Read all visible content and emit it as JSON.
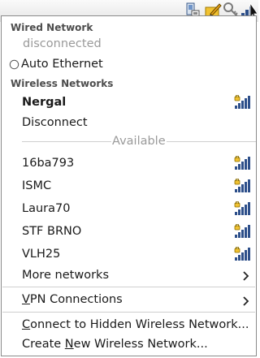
{
  "wired": {
    "header": "Wired Network",
    "status": "disconnected",
    "option": "Auto Ethernet"
  },
  "wireless": {
    "header": "Wireless Networks",
    "connected": "Nergal",
    "disconnect": "Disconnect",
    "available_label": "Available",
    "networks": [
      "16ba793",
      "ISMC",
      "Laura70",
      "STF BRNO",
      "VLH25"
    ],
    "more": "More networks"
  },
  "vpn": {
    "pre": "",
    "mnemonic": "V",
    "post": "PN Connections"
  },
  "hidden": {
    "pre": "",
    "mnemonic": "C",
    "post": "onnect to Hidden Wireless Network..."
  },
  "create": {
    "pre": "Create ",
    "mnemonic": "N",
    "post": "ew Wireless Network..."
  },
  "icons": {
    "tray": [
      "network-manager-icon",
      "edit-icon",
      "keys-icon",
      "signal-strength-icon"
    ],
    "signal": "signal-strength-lock-icon",
    "submenu": "chevron-right-icon"
  }
}
